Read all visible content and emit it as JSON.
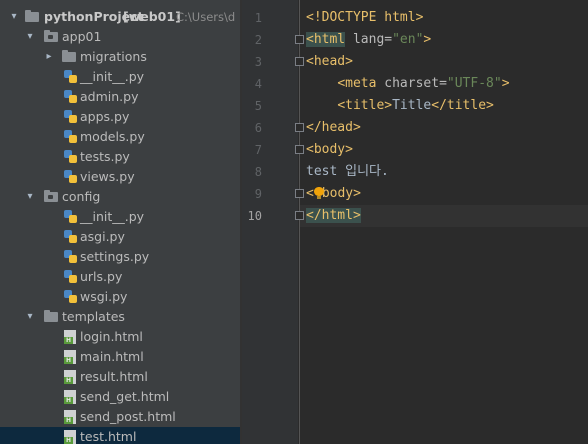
{
  "project_tree": {
    "root": {
      "name": "pythonProject",
      "module": "[web01]",
      "path": "C:\\Users\\d"
    },
    "items": [
      {
        "label": "app01",
        "type": "folder",
        "expanded": true
      },
      {
        "label": "migrations",
        "type": "folder",
        "expanded": false
      },
      {
        "label": "__init__.py",
        "type": "python-file"
      },
      {
        "label": "admin.py",
        "type": "python-file"
      },
      {
        "label": "apps.py",
        "type": "python-file"
      },
      {
        "label": "models.py",
        "type": "python-file"
      },
      {
        "label": "tests.py",
        "type": "python-file"
      },
      {
        "label": "views.py",
        "type": "python-file"
      },
      {
        "label": "config",
        "type": "folder",
        "expanded": true
      },
      {
        "label": "__init__.py",
        "type": "python-file"
      },
      {
        "label": "asgi.py",
        "type": "python-file"
      },
      {
        "label": "settings.py",
        "type": "python-file"
      },
      {
        "label": "urls.py",
        "type": "python-file"
      },
      {
        "label": "wsgi.py",
        "type": "python-file"
      },
      {
        "label": "templates",
        "type": "folder",
        "expanded": true
      },
      {
        "label": "login.html",
        "type": "html-file"
      },
      {
        "label": "main.html",
        "type": "html-file"
      },
      {
        "label": "result.html",
        "type": "html-file"
      },
      {
        "label": "send_get.html",
        "type": "html-file"
      },
      {
        "label": "send_post.html",
        "type": "html-file"
      },
      {
        "label": "test.html",
        "type": "html-file",
        "selected": true
      }
    ]
  },
  "editor": {
    "line_numbers": [
      "1",
      "2",
      "3",
      "4",
      "5",
      "6",
      "7",
      "8",
      "9",
      "10"
    ],
    "current_line": "10",
    "lines": {
      "l1": "<!DOCTYPE html>",
      "l2_open": "<html",
      "l2_attr": " lang=",
      "l2_str": "\"en\"",
      "l2_close": ">",
      "l3": "<head>",
      "l4_indent": "    ",
      "l4_open": "<meta",
      "l4_attr": " charset=",
      "l4_str": "\"UTF-8\"",
      "l4_close": ">",
      "l5_indent": "    ",
      "l5_open": "<title>",
      "l5_text": "Title",
      "l5_close": "</title>",
      "l6": "</head>",
      "l7": "<body>",
      "l8": "test 입니다.",
      "l9_a": "<",
      "l9_b": "body>",
      "l10": "</html>"
    }
  },
  "colors": {
    "tag": "#e8bf6a",
    "string": "#6a8759",
    "text": "#a9b7c6",
    "panel": "#3c3f41",
    "editor": "#2b2b2b"
  }
}
